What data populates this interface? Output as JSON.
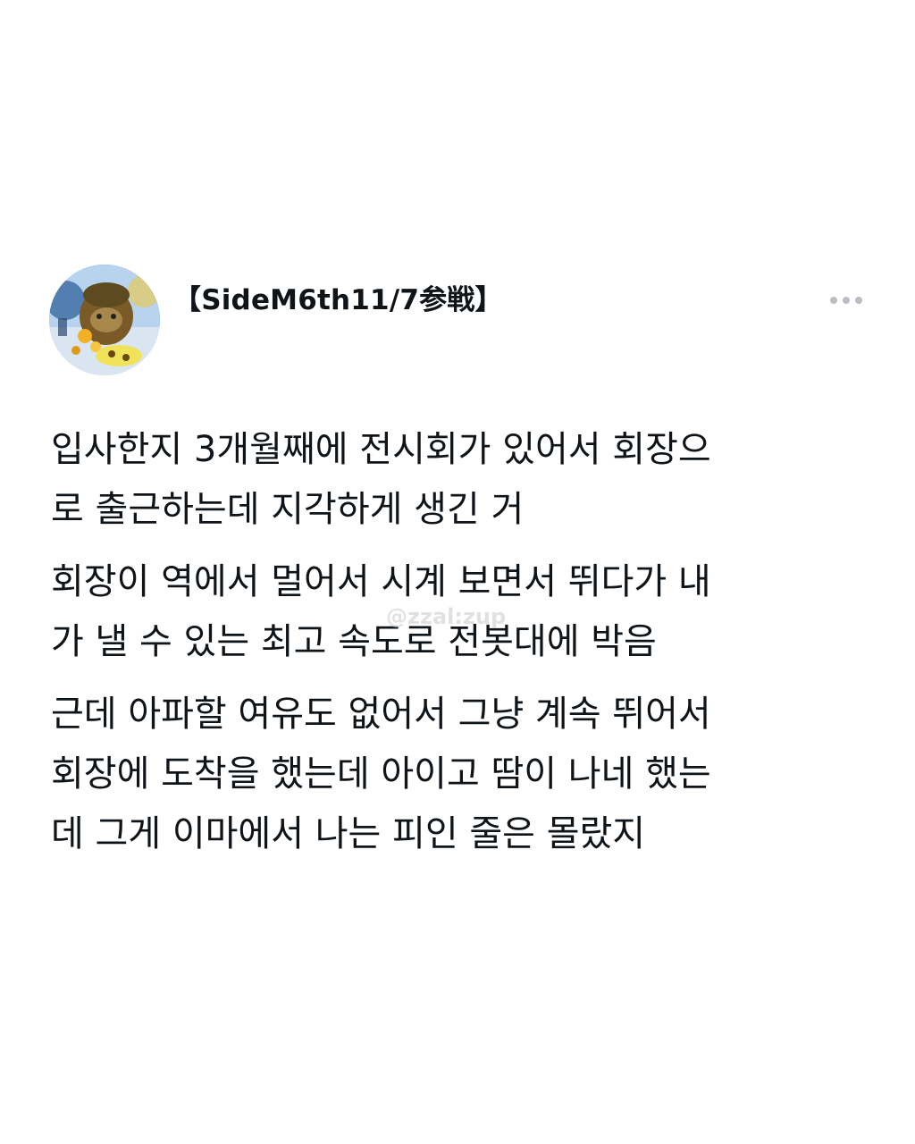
{
  "post": {
    "author": {
      "display_name": "【SideM6th11/7参戦】",
      "avatar_icon": "user-avatar-image"
    },
    "more_icon": "more-options-icon",
    "paragraphs": [
      {
        "lines": [
          "입사한지 3개월째에 전시회가 있어서 회장으",
          "로 출근하는데 지각하게 생긴 거"
        ]
      },
      {
        "lines": [
          "회장이 역에서 멀어서 시계 보면서 뛰다가 내",
          "가 낼 수 있는 최고 속도로 전봇대에 박음"
        ]
      },
      {
        "lines": [
          "근데 아파할 여유도 없어서 그냥 계속 뛰어서",
          "회장에 도착을 했는데 아이고 땀이 나네 했는",
          "데 그게 이마에서 나는 피인 줄은 몰랐지"
        ]
      }
    ],
    "watermark": "@zzal:zup",
    "colors": {
      "text": "#0f1419",
      "icon": "#b9bec4",
      "background": "#ffffff"
    }
  }
}
